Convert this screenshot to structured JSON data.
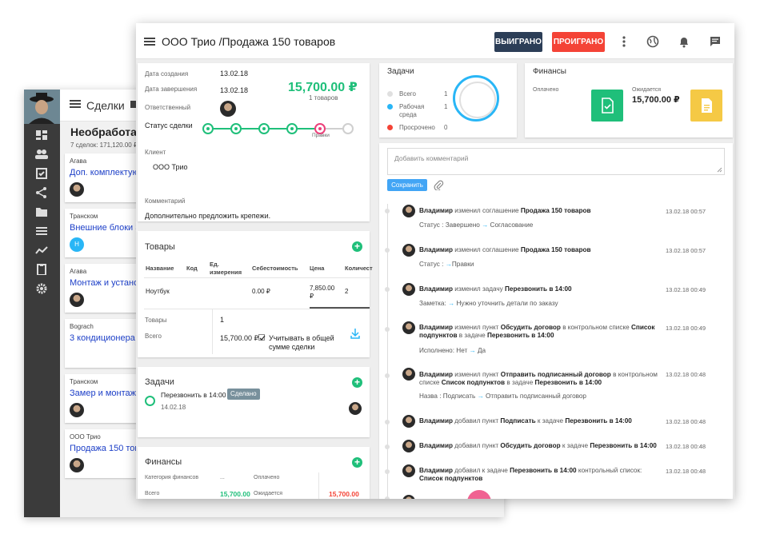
{
  "back": {
    "header_title": "Сделки",
    "column_title": "Необработан",
    "column_sum": "7 сделок: 171,120.00 ₽",
    "deals": [
      {
        "company": "Агава",
        "name": "Доп. комплектую"
      },
      {
        "company": "Транском",
        "name": "Внешние блоки 3",
        "avatar_letter": "Н"
      },
      {
        "company": "Агава",
        "name": "Монтаж и устано"
      },
      {
        "company": "Bograch",
        "name": "3 кондиционера"
      },
      {
        "company": "Транском",
        "name": "Замер и монтаж"
      },
      {
        "company": "ООО Трио",
        "name": "Продажа 150 тов"
      }
    ]
  },
  "header": {
    "title": "ООО Трио /Продажа 150 товаров",
    "won_label": "ВЫИГРАНО",
    "lost_label": "ПРОИГРАНО"
  },
  "info": {
    "created_label": "Дата создания",
    "created_value": "13.02.18",
    "completed_label": "Дата завершения",
    "completed_value": "13.02.18",
    "amount": "15,700.00 ₽",
    "items_count": "1 товаров",
    "responsible_label": "Ответственный",
    "status_label": "Статус сделки",
    "status_current": "Правки",
    "client_label": "Клиент",
    "client_value": "ООО Трио",
    "comment_label": "Комментарий",
    "comment_value": "Дополнительно предложить крепежи."
  },
  "goods": {
    "title": "Товары",
    "columns": [
      "Название",
      "Код",
      "Ед. измерения",
      "Себестоимость",
      "Цена",
      "Количест"
    ],
    "row": {
      "name": "Ноутбук",
      "code": "",
      "unit": "",
      "cost": "0.00 ₽",
      "price": "7,850.00 ₽",
      "qty": "2"
    },
    "goods_label": "Товары",
    "goods_value": "1",
    "total_label": "Всего",
    "total_value": "15,700.00 ₽",
    "include_label": "Учитывать в общей сумме сделки"
  },
  "tasks_card": {
    "title": "Задачи",
    "task_name": "Перезвонить в 14:00",
    "task_badge": "Сделано",
    "task_date": "14.02.18"
  },
  "finance_card": {
    "title": "Финансы",
    "category_label": "Категория финансов",
    "dots": "...",
    "paid_label": "Оплачено",
    "total_label": "Всего",
    "total_value": "15,700.00",
    "expected_label": "Ожидается",
    "expected_value": "15,700.00"
  },
  "tasks_widget": {
    "title": "Задачи",
    "legend": [
      {
        "label": "Всего",
        "count": "1",
        "color": "#e0e0e0"
      },
      {
        "label": "Рабочая среда",
        "count": "1",
        "color": "#29b6f6"
      },
      {
        "label": "Просрочено",
        "count": "0",
        "color": "#f44336"
      }
    ]
  },
  "finance_widget": {
    "title": "Финансы",
    "paid_label": "Оплачено",
    "expected_label": "Ожидается",
    "expected_value": "15,700.00 ₽",
    "paid_color": "#1fbf7a",
    "expected_color": "#f5c945"
  },
  "comments": {
    "placeholder": "Добавить комментарий",
    "save_label": "Сохранить"
  },
  "timeline": [
    {
      "user": "Владимир",
      "action": "изменил соглашение",
      "target": "Продажа 150 товаров",
      "date": "13.02.18 00:57",
      "sub_key": "Статус :",
      "sub_from": "Завершено",
      "sub_to": "Согласование"
    },
    {
      "user": "Владимир",
      "action": "изменил соглашение",
      "target": "Продажа 150 товаров",
      "date": "13.02.18 00:57",
      "sub_key": "Статус :",
      "sub_from": "",
      "sub_to": "Правки"
    },
    {
      "user": "Владимир",
      "action": "изменил задачу",
      "target": "Перезвонить в 14:00",
      "date": "13.02.18 00:49",
      "sub_key": "Заметка:",
      "sub_from": "",
      "sub_to": "Нужно уточнить детали по заказу"
    },
    {
      "user": "Владимир",
      "line1": "изменил пункт",
      "b1": "Обсудить договор",
      "line2": "в контрольном списке",
      "b2": "Список",
      "line3": "подпунктов",
      "line3_mid": "в задаче",
      "b3": "Перезвонить в 14:00",
      "date": "13.02.18 00:49",
      "sub_key": "Исполнено:",
      "sub_from": "Нет",
      "sub_to": "Да"
    },
    {
      "user": "Владимир",
      "line1": "изменил пункт",
      "b1": "Отправить подписанный договор",
      "line2": "в контрольном",
      "line3a": "списке",
      "b2": "Список подпунктов",
      "line3_mid": "в задаче",
      "b3": "Перезвонить в 14:00",
      "date": "13.02.18 00:48",
      "sub_key": "Назва : Подписать",
      "sub_from": "",
      "sub_to": "Отправить подписанный договор"
    },
    {
      "user": "Владимир",
      "action": "добавил пункт",
      "target": "Подписать",
      "mid": "к задаче",
      "target2": "Перезвонить в 14:00",
      "date": "13.02.18 00:48"
    },
    {
      "user": "Владимир",
      "action": "добавил пункт",
      "target": "Обсудить договор",
      "mid": "к задаче",
      "target2": "Перезвонить в 14:00",
      "date": "13.02.18 00:48"
    },
    {
      "user": "Владимир",
      "action": "добавил к задаче",
      "target": "Перезвонить в 14:00",
      "mid": "контрольный список:",
      "target2": "Список подпунктов",
      "date": "13.02.18 00:48"
    }
  ]
}
